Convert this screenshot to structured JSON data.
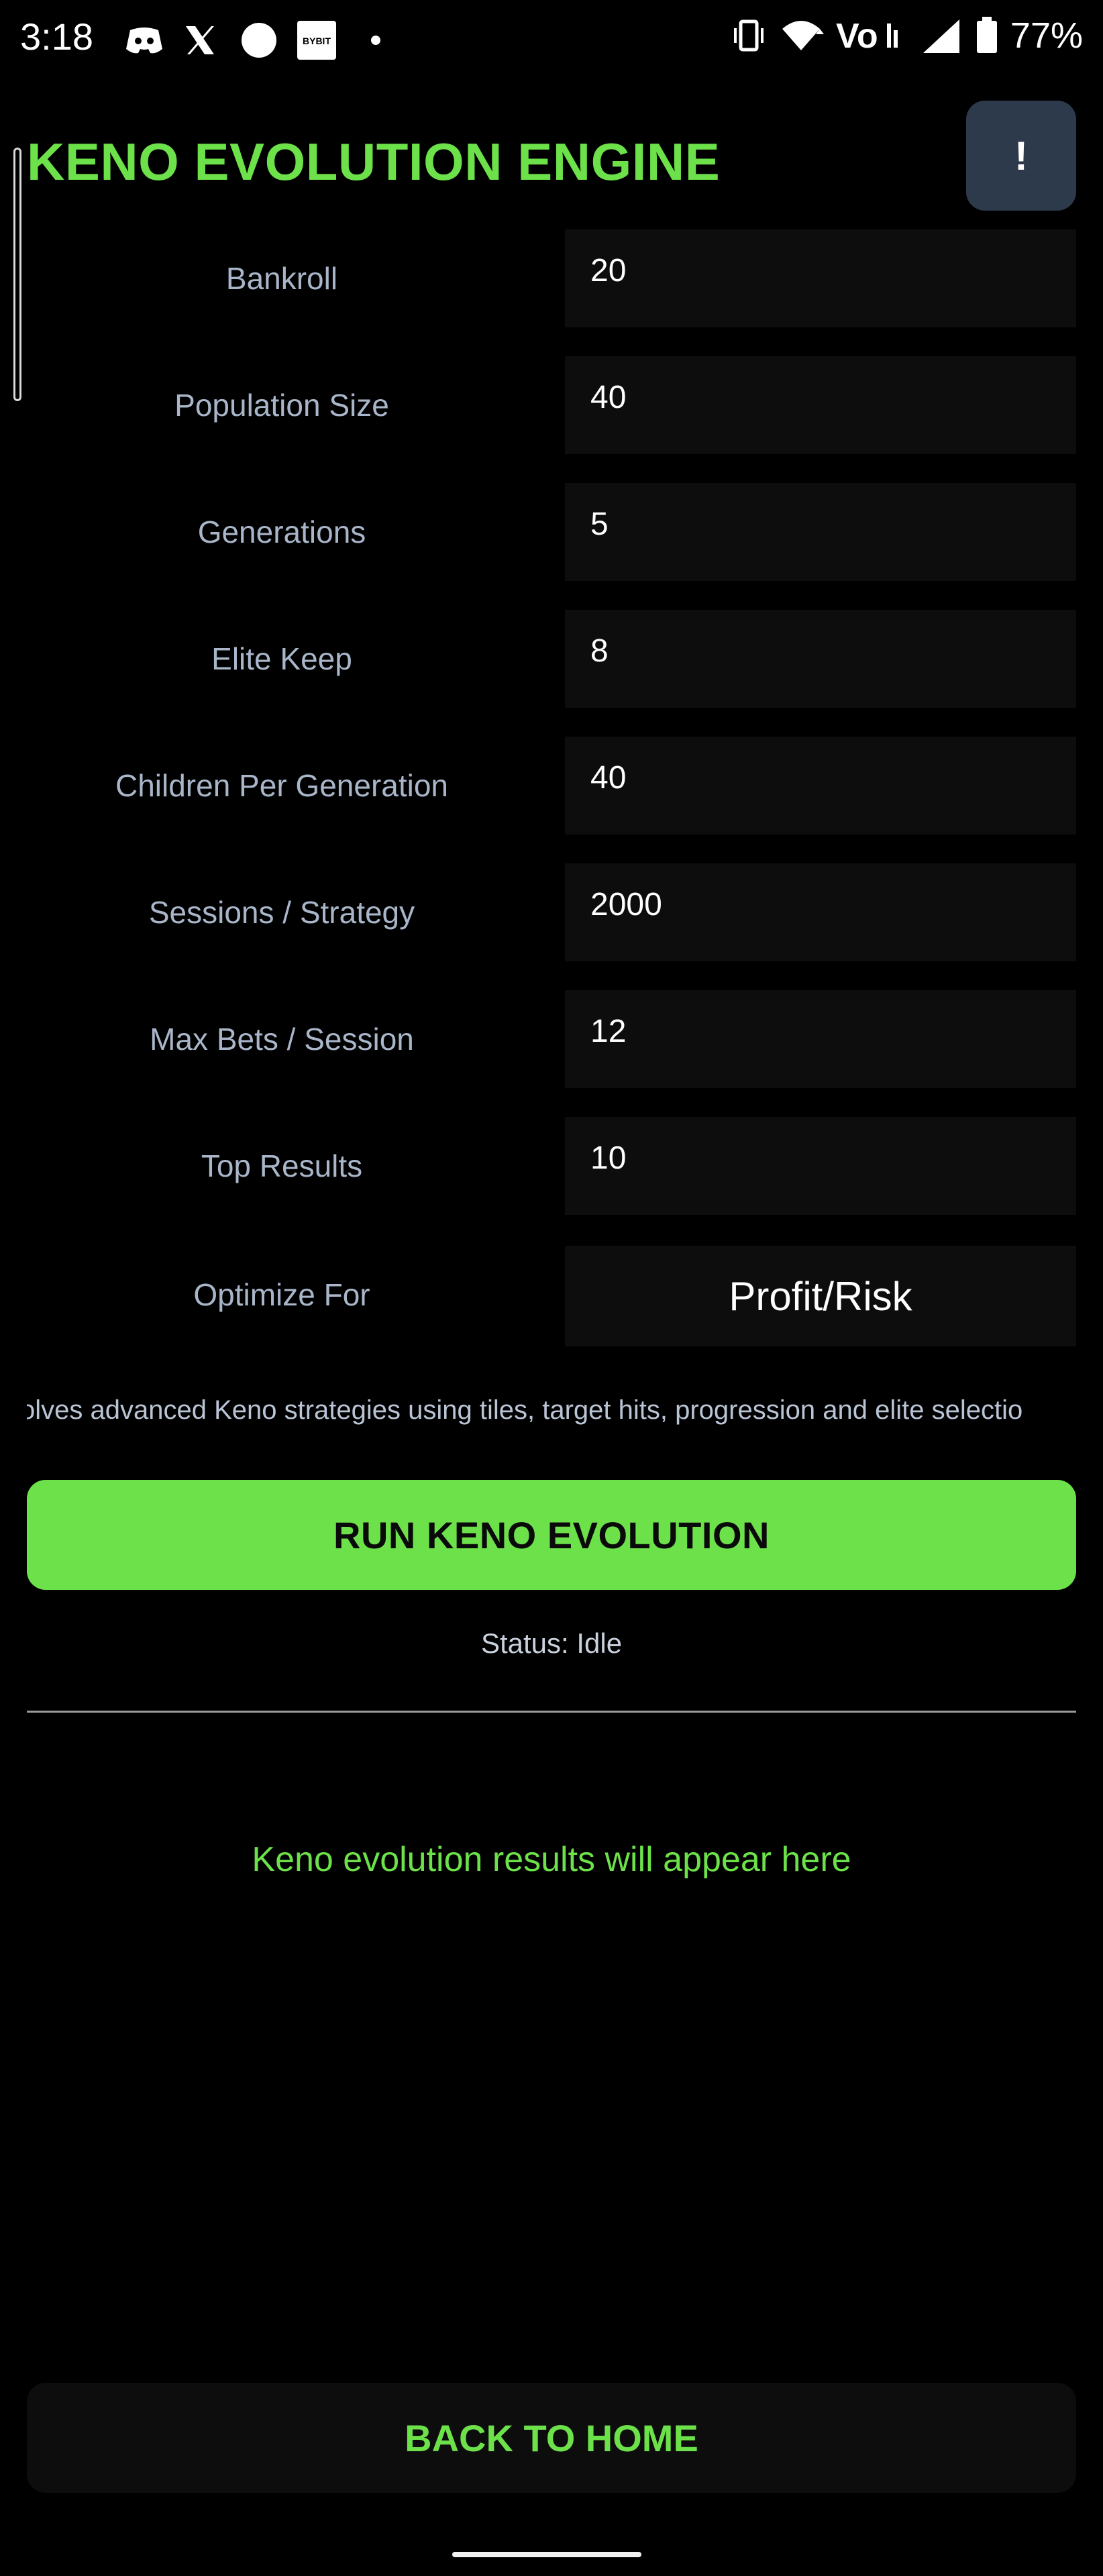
{
  "status_bar": {
    "time": "3:18",
    "battery": "77%",
    "left_icons": [
      "discord-icon",
      "x-icon",
      "circle-icon",
      "bybit-icon",
      "dot-icon"
    ],
    "bybit_label": "BYBIT",
    "right_icons": [
      "vibrate-icon",
      "wifi-icon",
      "volte-icon",
      "signal-icon",
      "battery-icon"
    ]
  },
  "header": {
    "title": "KENO EVOLUTION ENGINE",
    "info_label": "!"
  },
  "form": {
    "rows": [
      {
        "label": "Bankroll",
        "value": "20"
      },
      {
        "label": "Population Size",
        "value": "40"
      },
      {
        "label": "Generations",
        "value": "5"
      },
      {
        "label": "Elite Keep",
        "value": "8"
      },
      {
        "label": "Children Per Generation",
        "value": "40"
      },
      {
        "label": "Sessions / Strategy",
        "value": "2000"
      },
      {
        "label": "Max Bets / Session",
        "value": "12"
      },
      {
        "label": "Top Results",
        "value": "10"
      }
    ],
    "optimize": {
      "label": "Optimize For",
      "value": "Profit/Risk"
    }
  },
  "description": "volves advanced Keno strategies using tiles, target hits, progression and elite selectio",
  "run_button": "RUN KENO EVOLUTION",
  "status": "Status: Idle",
  "results_placeholder": "Keno evolution results will appear here",
  "back_button": "BACK TO HOME",
  "colors": {
    "accent": "#6ce14a",
    "background": "#000000",
    "input_bg": "#0d0d0d",
    "label": "#a9b6c9",
    "info_btn": "#2d3a4b"
  }
}
